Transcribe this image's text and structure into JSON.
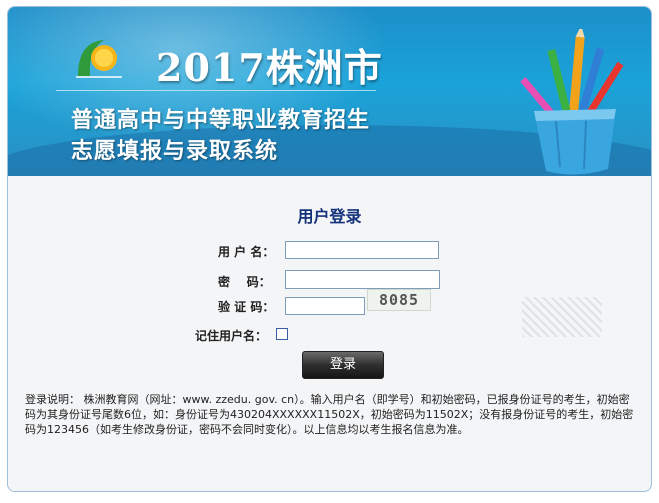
{
  "header": {
    "year_title": "2017株洲市",
    "title_line1": "普通高中与中等职业教育招生",
    "title_line2": "志愿填报与录取系统",
    "logo_icon": "sun-sprout-logo",
    "illustration_icon": "pencil-cup-illustration"
  },
  "login": {
    "title": "用户登录",
    "username_label": "用 户 名：",
    "password_label": "密    码：",
    "captcha_label": "验 证 码：",
    "captcha_code": "8085",
    "remember_label": "记住用户名：",
    "submit_label": "登录",
    "username_value": "",
    "password_value": "",
    "captcha_value": ""
  },
  "instructions": "登录说明： 株洲教育网（网址：www. zzedu. gov. cn）。输入用户名（即学号）和初始密码，已报身份证号的考生，初始密码为其身份证号尾数6位，如：身份证号为430204XXXXXX11502X，初始密码为11502X；没有报身份证号的考生，初始密码为123456（如考生修改身份证，密码不会同时变化）。以上信息均以考生报名信息为准。",
  "colors": {
    "banner_blue": "#1aa3d9",
    "title_navy": "#14327a",
    "button_dark": "#2f2f2f"
  }
}
